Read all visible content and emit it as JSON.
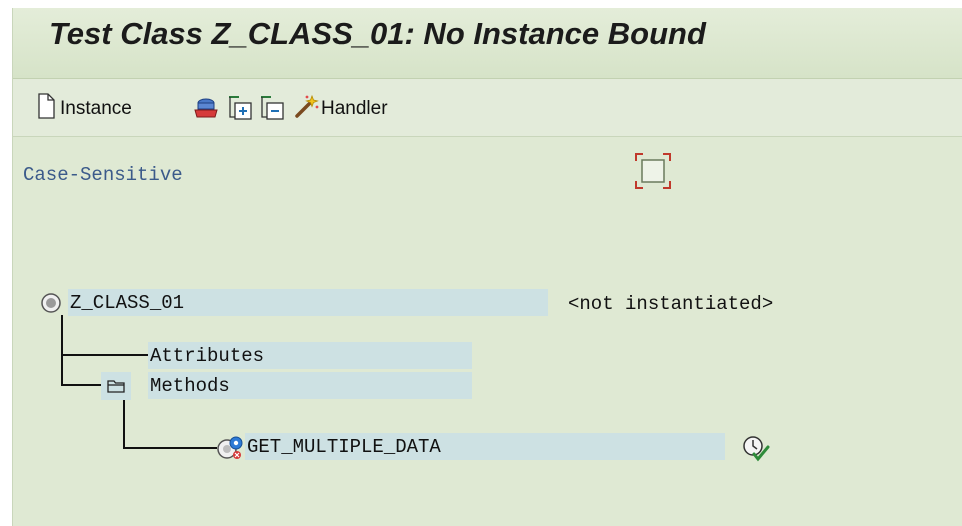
{
  "window": {
    "title": "Test Class Z_CLASS_01: No Instance Bound"
  },
  "toolbar": {
    "instance_label": "Instance",
    "handler_label": "Handler",
    "icons": [
      "document-icon",
      "cube-icon",
      "expand-tree-icon",
      "collapse-tree-icon",
      "magic-wand-icon"
    ]
  },
  "options": {
    "case_sensitive_label": "Case-Sensitive"
  },
  "tree": {
    "root": {
      "name": "Z_CLASS_01",
      "status": "<not instantiated>"
    },
    "attributes_label": "Attributes",
    "methods_label": "Methods",
    "method": {
      "name": "GET_MULTIPLE_DATA"
    }
  },
  "colors": {
    "background": "#dfe9d3",
    "node_highlight": "#cde1e3",
    "accent_red": "#c0392b",
    "execute_green": "#2e8b3a"
  }
}
